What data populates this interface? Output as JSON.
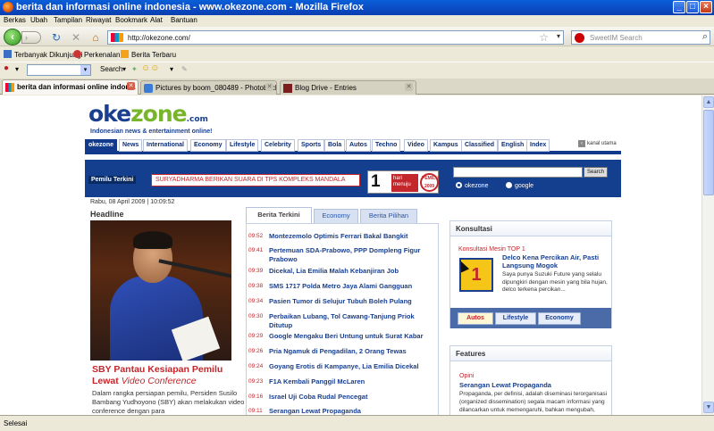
{
  "window": {
    "title": "berita dan informasi online indonesia - www.okezone.com - Mozilla Firefox",
    "buttons": {
      "minimize": "_",
      "maximize": "□",
      "close": "×"
    }
  },
  "menu": [
    "Berkas",
    "Ubah",
    "Tampilan",
    "Riwayat",
    "Bookmark",
    "Alat",
    "Bantuan"
  ],
  "navbar": {
    "url": "http://okezone.com/",
    "search_placeholder": "SweetIM Search"
  },
  "bookmarks": [
    "Terbanyak Dikunjungi",
    "Perkenalan",
    "Berita Terbaru"
  ],
  "toolbar2": {
    "search_label": "Search"
  },
  "tabs": [
    {
      "title": "berita dan informasi online indon...",
      "active": true
    },
    {
      "title": "Pictures by boom_080489 - Photobucket",
      "active": false
    },
    {
      "title": "Blog Drive - Entries",
      "active": false
    }
  ],
  "status": "Selesai",
  "site": {
    "logo_oke": "oke",
    "logo_zone": "zone",
    "logo_com": ".com",
    "tagline": "Indonesian news & entertainment online!",
    "categories": [
      "okezone",
      "News",
      "International",
      "Economy",
      "Lifestyle",
      "Celebrity",
      "Sports",
      "Bola",
      "Autos",
      "Techno",
      "Video",
      "Kampus",
      "Classified",
      "English",
      "Index"
    ],
    "kanal_utama": "kanal utama",
    "pemilu_label": "Pemilu Terkini",
    "pemilu_ticker": "SURYADHARMA BERIKAN SUARA DI TPS KOMPLEKS MANDALA",
    "countdown": {
      "number": "1",
      "text": "hari menuju",
      "badge": "PEMILU 2009"
    },
    "search_button": "Search",
    "search_options": [
      "okezone",
      "google"
    ],
    "date": "Rabu, 08 April 2009 | 10:09:52",
    "headline_label": "Headline",
    "headline_title": "SBY Pantau Kesiapan Pemilu Lewat ",
    "headline_title_italic": "Video Conference",
    "headline_desc": "Dalam rangka persiapan pemilu, Persiden Susilo Bambang Yudhoyono (SBY) akan melakukan video conference dengan para",
    "news_tabs": [
      "Berita Terkini",
      "Economy",
      "Berita Pilihan"
    ],
    "news": [
      {
        "time": "09:52",
        "title": "Montezemolo Optimis Ferrari Bakal Bangkit"
      },
      {
        "time": "09:41",
        "title": "Pertemuan SDA-Prabowo, PPP Dompleng Figur Prabowo"
      },
      {
        "time": "09:39",
        "title": "Dicekal, Lia Emilia Malah Kebanjiran Job"
      },
      {
        "time": "09:38",
        "title": "SMS 1717 Polda Metro Jaya Alami Gangguan"
      },
      {
        "time": "09:34",
        "title": "Pasien Tumor di Selujur Tubuh Boleh Pulang"
      },
      {
        "time": "09:30",
        "title": "Perbaikan Lubang, Tol Cawang-Tanjung Priok Ditutup"
      },
      {
        "time": "09:29",
        "title": "Google Mengaku Beri Untung untuk Surat Kabar"
      },
      {
        "time": "09:26",
        "title": "Pria Ngamuk di Pengadilan, 2 Orang Tewas"
      },
      {
        "time": "09:24",
        "title": "Goyang Erotis di Kampanye, Lia Emilia Dicekal"
      },
      {
        "time": "09:23",
        "title": "F1A Kembali Panggil McLaren"
      },
      {
        "time": "09:16",
        "title": "Israel Uji Coba Rudal Pencegat"
      },
      {
        "time": "09:11",
        "title": "Serangan Lewat Propaganda"
      }
    ],
    "konsultasi": {
      "header": "Konsultasi",
      "sub": "Konsultasi Mesin TOP 1",
      "logo": "1",
      "title": "Delco Kena Percikan Air, Pasti Langsung Mogok",
      "desc": "Saya punya Suzuki Future yang selalu dipungkiri dengan mesin yang bila hujan, delco terkena percikan...",
      "tabs": [
        "Autos",
        "Lifestyle",
        "Economy"
      ]
    },
    "features": {
      "header": "Features",
      "opini": "Opini",
      "title": "Serangan Lewat Propaganda",
      "desc": "Propaganda, per definisi, adalah diseminasi terorganisasi (organized dissemination) segala macam informasi yang dilancarkan untuk memengaruhi, bahkan mengubah, kepercayaan,"
    }
  }
}
